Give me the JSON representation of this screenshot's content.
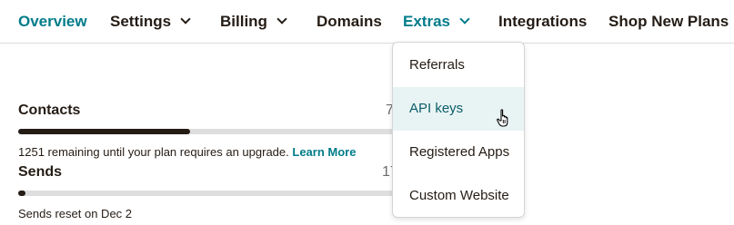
{
  "nav": {
    "items": [
      {
        "label": "Overview",
        "accent": true,
        "chevron": false
      },
      {
        "label": "Settings",
        "accent": false,
        "chevron": true
      },
      {
        "label": "Billing",
        "accent": false,
        "chevron": true
      },
      {
        "label": "Domains",
        "accent": false,
        "chevron": false
      },
      {
        "label": "Extras",
        "accent": true,
        "chevron": true
      },
      {
        "label": "Integrations",
        "accent": false,
        "chevron": false
      },
      {
        "label": "Shop New Plans",
        "accent": false,
        "chevron": false
      }
    ]
  },
  "usage": {
    "contacts": {
      "label": "Contacts",
      "value_partial": "7",
      "fill_fraction": 0.45,
      "note": "1251 remaining until your plan requires an upgrade.",
      "note_link": "Learn More"
    },
    "sends": {
      "label": "Sends",
      "value_partial": "17",
      "fill_fraction": 0.02,
      "note": "Sends reset on Dec 2"
    }
  },
  "extras_menu": {
    "items": [
      {
        "label": "Referrals",
        "active": false
      },
      {
        "label": "API keys",
        "active": true
      },
      {
        "label": "Registered Apps",
        "active": false
      },
      {
        "label": "Custom Website",
        "active": false
      }
    ]
  },
  "colors": {
    "accent": "#007c89",
    "text": "#241c15",
    "bar_track": "#dedede",
    "menu_highlight": "#e8f3f4"
  }
}
